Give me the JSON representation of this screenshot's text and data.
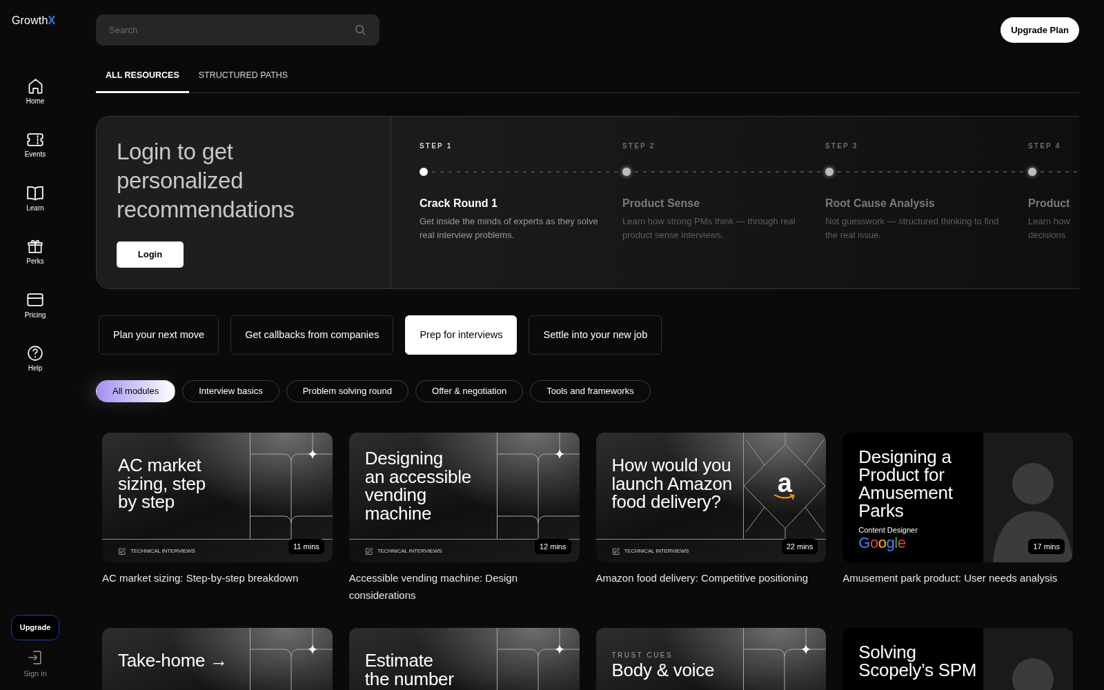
{
  "sidebar": {
    "logo": {
      "text": "Growth",
      "accent": "X"
    },
    "items": [
      {
        "label": "Home",
        "selected": false
      },
      {
        "label": "Events",
        "selected": false
      },
      {
        "label": "Learn",
        "selected": false
      },
      {
        "label": "Perks",
        "selected": false
      },
      {
        "label": "Pricing",
        "selected": false
      },
      {
        "label": "Help",
        "selected": false
      }
    ],
    "upgrade_button": "Upgrade",
    "sign_in": "Sign in"
  },
  "header": {
    "search": {
      "placeholder": "Search"
    },
    "upgrade_button": "Upgrade Plan"
  },
  "tabs": [
    {
      "label": "ALL RESOURCES",
      "selected": true
    },
    {
      "label": "STRUCTURED PATHS",
      "selected": false
    }
  ],
  "hero": {
    "heading": "Login to get personalized recommendations",
    "login_button": "Login",
    "steps": [
      {
        "label": "STEP 1",
        "title": "Crack Round 1",
        "description": "Get inside the minds of experts as they solve real interview problems.",
        "dimmed": false
      },
      {
        "label": "STEP 2",
        "title": "Product Sense",
        "description": "Learn how strong PMs think — through real product sense interviews.",
        "dimmed": true
      },
      {
        "label": "STEP 3",
        "title": "Root Cause Analysis",
        "description": "Not guesswork — structured thinking to find the real issue.",
        "dimmed": true
      },
      {
        "label": "STEP 4",
        "title": "Product",
        "description": "Learn how decisions",
        "dimmed": true
      }
    ]
  },
  "goals": [
    {
      "label": "Plan your next move",
      "selected": false
    },
    {
      "label": "Get callbacks from companies",
      "selected": false
    },
    {
      "label": "Prep for interviews",
      "selected": true
    },
    {
      "label": "Settle into your new job",
      "selected": false
    }
  ],
  "filters": [
    {
      "label": "All modules",
      "selected": true
    },
    {
      "label": "Interview basics",
      "selected": false
    },
    {
      "label": "Problem solving round",
      "selected": false
    },
    {
      "label": "Offer & negotiation",
      "selected": false
    },
    {
      "label": "Tools and frameworks",
      "selected": false
    }
  ],
  "cards": [
    {
      "thumbnail": {
        "kind": "pattern",
        "heading_lines": [
          "AC market",
          "sizing, step",
          "by step"
        ],
        "tag": "TECHNICAL INTERVIEWS",
        "duration": "11 mins"
      },
      "title": "AC market sizing: Step-by-step breakdown"
    },
    {
      "thumbnail": {
        "kind": "pattern",
        "heading_lines": [
          "Designing",
          "an accessible",
          "vending",
          "machine"
        ],
        "tag": "TECHNICAL INTERVIEWS",
        "duration": "12 mins"
      },
      "title": "Accessible vending machine: Design considerations"
    },
    {
      "thumbnail": {
        "kind": "diamond",
        "heading_lines": [
          "How would you",
          "launch Amazon",
          "food delivery?"
        ],
        "logo_text": "a",
        "tag": "TECHNICAL INTERVIEWS",
        "duration": "22 mins"
      },
      "title": "Amazon food delivery: Competitive positioning"
    },
    {
      "thumbnail": {
        "kind": "portrait",
        "heading_lines": [
          "Designing a",
          "Product for",
          "Amusement",
          "Parks"
        ],
        "role": "Content Designer",
        "company": "Google",
        "duration": "17 mins"
      },
      "title": "Amusement park product: User needs analysis"
    },
    {
      "thumbnail": {
        "kind": "pattern",
        "heading_lines": [
          "Take-home →"
        ]
      }
    },
    {
      "thumbnail": {
        "kind": "pattern",
        "heading_lines": [
          "Estimate",
          "the number"
        ]
      }
    },
    {
      "thumbnail": {
        "kind": "pattern",
        "eyebrow": "TRUST CUES",
        "heading_lines": [
          "Body & voice"
        ]
      }
    },
    {
      "thumbnail": {
        "kind": "portrait",
        "heading_lines": [
          "Solving",
          "Scopely’s SPM"
        ]
      }
    }
  ]
}
